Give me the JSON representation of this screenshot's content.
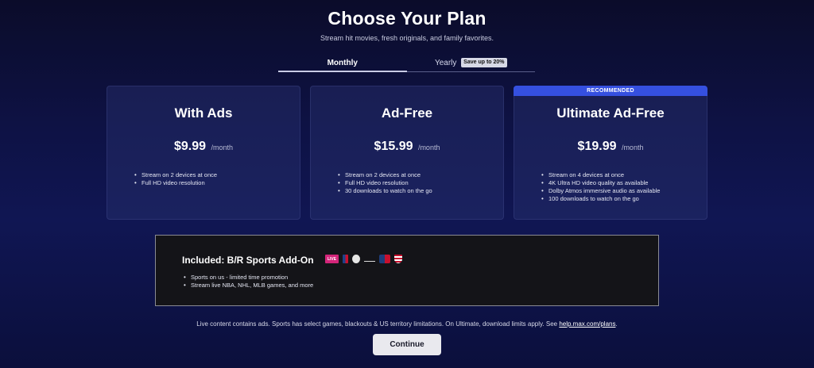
{
  "header": {
    "title": "Choose Your Plan",
    "subtitle": "Stream hit movies, fresh originals, and family favorites."
  },
  "tabs": {
    "monthly": "Monthly",
    "yearly": "Yearly",
    "yearly_badge": "Save up to 20%",
    "active": "monthly"
  },
  "plans": [
    {
      "name": "With Ads",
      "price": "$9.99",
      "period": "/month",
      "features": [
        "Stream on 2 devices at once",
        "Full HD video resolution"
      ]
    },
    {
      "name": "Ad-Free",
      "price": "$15.99",
      "period": "/month",
      "features": [
        "Stream on 2 devices at once",
        "Full HD video resolution",
        "30 downloads to watch on the go"
      ]
    },
    {
      "name": "Ultimate Ad-Free",
      "price": "$19.99",
      "period": "/month",
      "badge": "RECOMMENDED",
      "features": [
        "Stream on 4 devices at once",
        "4K Ultra HD video quality as available",
        "Dolby Atmos immersive audio as available",
        "100 downloads to watch on the go"
      ]
    }
  ],
  "sports": {
    "title": "Included: B/R Sports Add-On",
    "logos": [
      "live-badge",
      "nba-logo",
      "nhl-logo",
      "tnt-sports-logo",
      "mlb-logo",
      "us-soccer-logo"
    ],
    "live_label": "LIVE",
    "features": [
      "Sports on us - limited time promotion",
      "Stream live NBA, NHL, MLB games, and more"
    ]
  },
  "footer": {
    "disclaimer": "Live content contains ads. Sports has select games, blackouts & US territory limitations. On Ultimate, download limits apply. See ",
    "link": "help.max.com/plans",
    "disclaimer_end": ".",
    "continue_label": "Continue"
  },
  "colors": {
    "background": "#0e1245",
    "recommended": "#3550e0",
    "button": "#e9e9ee"
  }
}
